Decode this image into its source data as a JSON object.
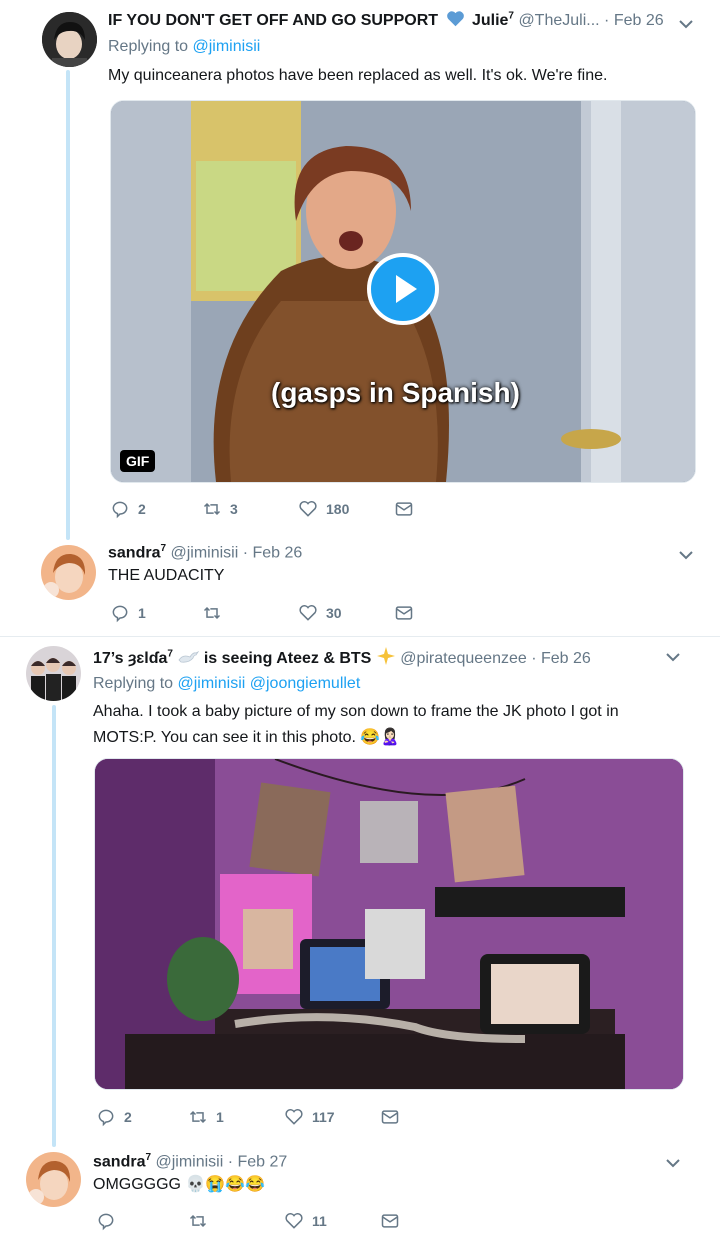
{
  "tweets": [
    {
      "display_name": "IF YOU DON'T GET OFF AND GO SUPPORT",
      "display_name_2": "Julie",
      "sup": "7",
      "handle": "@TheJuli...",
      "date": "· Feb 26",
      "replying_prefix": "Replying to",
      "replying_to": "@jiminisii",
      "text": "My quinceanera photos have been replaced as well. It's ok. We're fine.",
      "media": {
        "caption": "(gasps in Spanish)",
        "badge": "GIF"
      },
      "actions": {
        "replies": "2",
        "retweets": "3",
        "likes": "180"
      }
    },
    {
      "display_name": "sandra",
      "sup": "7",
      "handle": "@jiminisii",
      "date": "· Feb 26",
      "text": "THE AUDACITY",
      "actions": {
        "replies": "1",
        "retweets": "",
        "likes": "30"
      }
    },
    {
      "display_name": "17’s ȝɛlɗa",
      "sup": "7",
      "display_name_suffix": "is seeing Ateez & BTS",
      "handle": "@piratequeenzee",
      "date": "· Feb 26",
      "replying_prefix": "Replying to",
      "replying_to": "@jiminisii @joongiemullet",
      "text_line1": "Ahaha. I took a baby picture of my son down to frame the JK photo I got in",
      "text_line2": "MOTS:P. You can see it in this photo. 😂🙎🏻‍♀️",
      "actions": {
        "replies": "2",
        "retweets": "1",
        "likes": "117"
      }
    },
    {
      "display_name": "sandra",
      "sup": "7",
      "handle": "@jiminisii",
      "date": "· Feb 27",
      "text": "OMGGGGG 💀😭😂😂",
      "actions": {
        "replies": "",
        "retweets": "",
        "likes": "11"
      }
    }
  ],
  "colors": {
    "accent": "#1da1f2",
    "muted": "#657786",
    "thread_line": "#c4e4f7"
  }
}
